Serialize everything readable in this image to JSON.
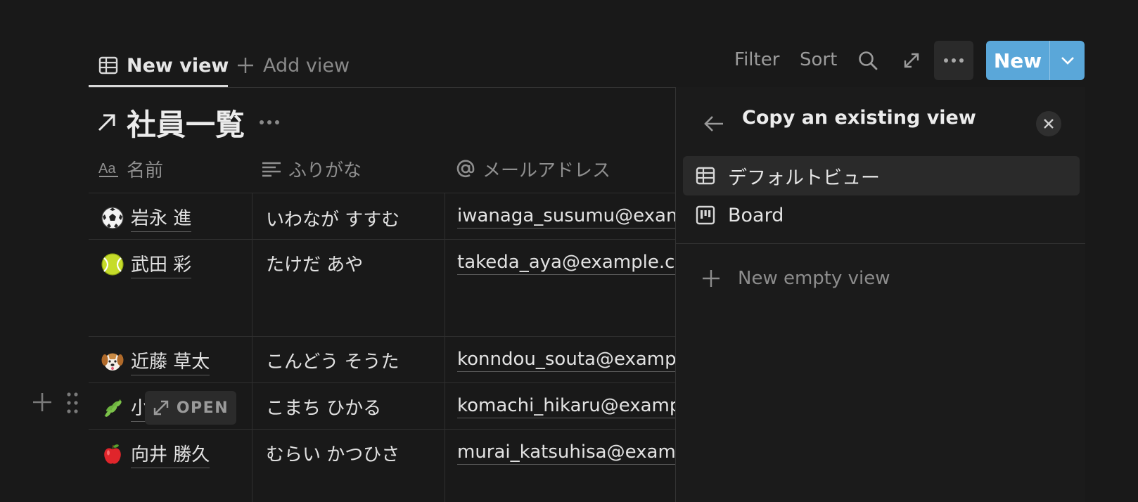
{
  "tabs": {
    "active_label": "New view",
    "add_label": "Add view"
  },
  "toolbar": {
    "filter_label": "Filter",
    "sort_label": "Sort",
    "new_label": "New"
  },
  "database": {
    "title": "社員一覧"
  },
  "table": {
    "columns": [
      {
        "label": "名前",
        "icon": "title-aa-icon"
      },
      {
        "label": "ふりがな",
        "icon": "text-lines-icon"
      },
      {
        "label": "メールアドレス",
        "icon": "at-sign-icon"
      }
    ],
    "rows": [
      {
        "emoji": "soccer-ball-icon",
        "name": "岩永 進",
        "furigana": "いわなが すすむ",
        "email": "iwanaga_susumu@example.com"
      },
      {
        "emoji": "tennis-ball-icon",
        "name": "武田 彩",
        "furigana": "たけだ あや",
        "email": "takeda_aya@example.com"
      },
      {
        "emoji": "dog-face-icon",
        "name": "近藤 草太",
        "furigana": "こんどう そうた",
        "email": "konndou_souta@example.com"
      },
      {
        "emoji": "herb-icon",
        "name": "小",
        "furigana": "こまち ひかる",
        "email": "komachi_hikaru@example.com"
      },
      {
        "emoji": "apple-icon",
        "name": "向井 勝久",
        "furigana": "むらい かつひさ",
        "email": "murai_katsuhisa@example.com"
      }
    ],
    "open_chip_label": "OPEN"
  },
  "panel": {
    "title": "Copy an existing view",
    "views": [
      {
        "label": "デフォルトビュー",
        "icon": "table-icon",
        "selected": true
      },
      {
        "label": "Board",
        "icon": "board-icon",
        "selected": false
      }
    ],
    "new_empty_label": "New empty view"
  }
}
